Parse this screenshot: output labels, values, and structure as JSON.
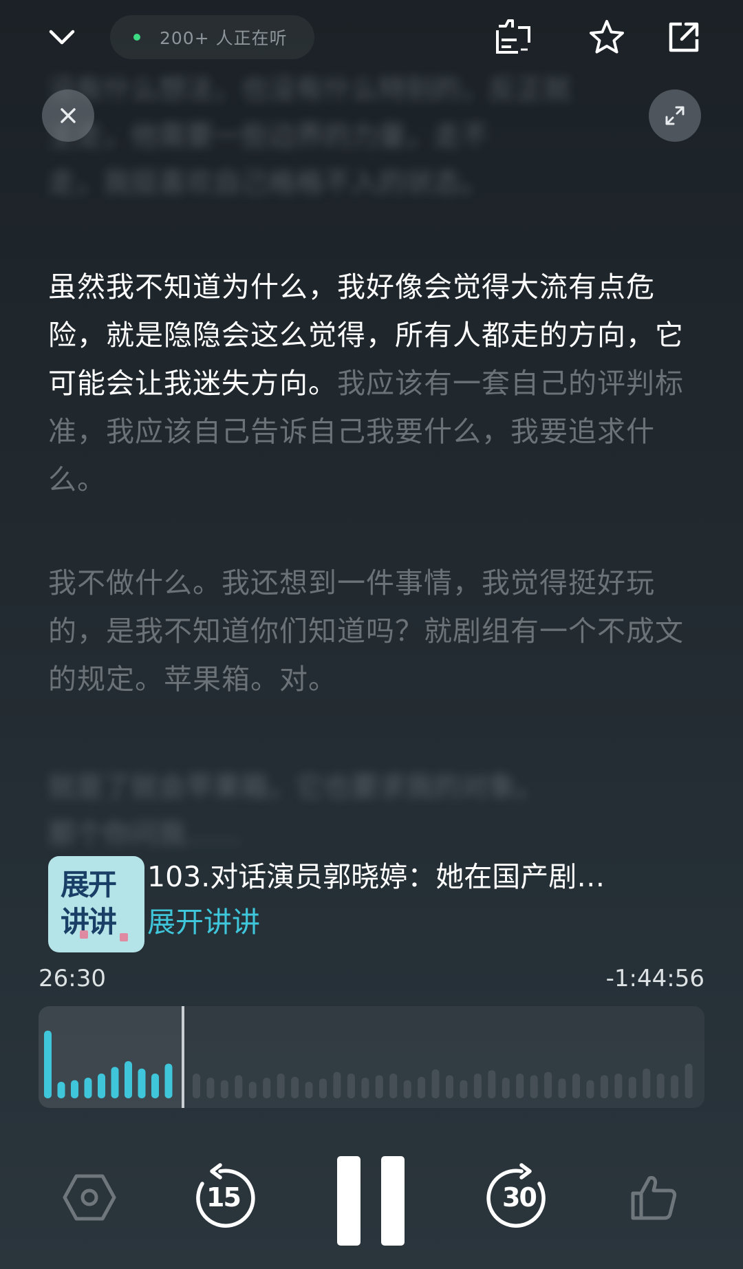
{
  "header": {
    "listening_count": "200+ 人正在听",
    "icons": [
      "chevron-down-icon",
      "share-ctr-icon",
      "star-icon",
      "external-share-icon"
    ]
  },
  "overlay_buttons": {
    "close_icon": "close-icon",
    "expand_icon": "expand-icon"
  },
  "transcript": {
    "blurred_top": [
      "没有什么想法，也没有什么特别的，反正就",
      "主走，他需要一些边界的力量，走不",
      "走，我挺喜欢自己格格不入的状态。"
    ],
    "para1_active": "虽然我不知道为什么，我好像会觉得大流有点危险，就是隐隐会这么觉得，所有人都走的方向，它可能会让我迷失方向。",
    "para1_rest": "我应该有一套自己的评判标准，我应该自己告诉自己我要什么，我要追求什么。",
    "para2": "我不做什么。我还想到一件事情，我觉得挺好玩的，是我不知道你们知道吗？就剧组有一个不成文的规定。苹果箱。对。",
    "blurred_bottom": [
      "就是了就会苹果箱，它也要求我的对象。",
      "那个你问我……"
    ]
  },
  "episode": {
    "cover_line1": "展开",
    "cover_line2": "讲讲",
    "title": "103.对话演员郭晓婷：她在国产剧…",
    "show": "展开讲讲"
  },
  "player": {
    "current_time": "26:30",
    "remaining_time": "-1:44:56",
    "progress_fraction": 0.2,
    "accent_color": "#3fc6da",
    "waveform_played": [
      0.82,
      0.2,
      0.22,
      0.25,
      0.3,
      0.38,
      0.45,
      0.36,
      0.3,
      0.42
    ],
    "waveform_unplayed": [
      0.3,
      0.25,
      0.22,
      0.28,
      0.2,
      0.25,
      0.3,
      0.26,
      0.2,
      0.24,
      0.32,
      0.3,
      0.25,
      0.28,
      0.3,
      0.22,
      0.26,
      0.35,
      0.28,
      0.22,
      0.3,
      0.34,
      0.25,
      0.3,
      0.28,
      0.32,
      0.24,
      0.3,
      0.22,
      0.28,
      0.3,
      0.26,
      0.36,
      0.3,
      0.28,
      0.42
    ],
    "skip_back": "15",
    "skip_forward": "30"
  }
}
